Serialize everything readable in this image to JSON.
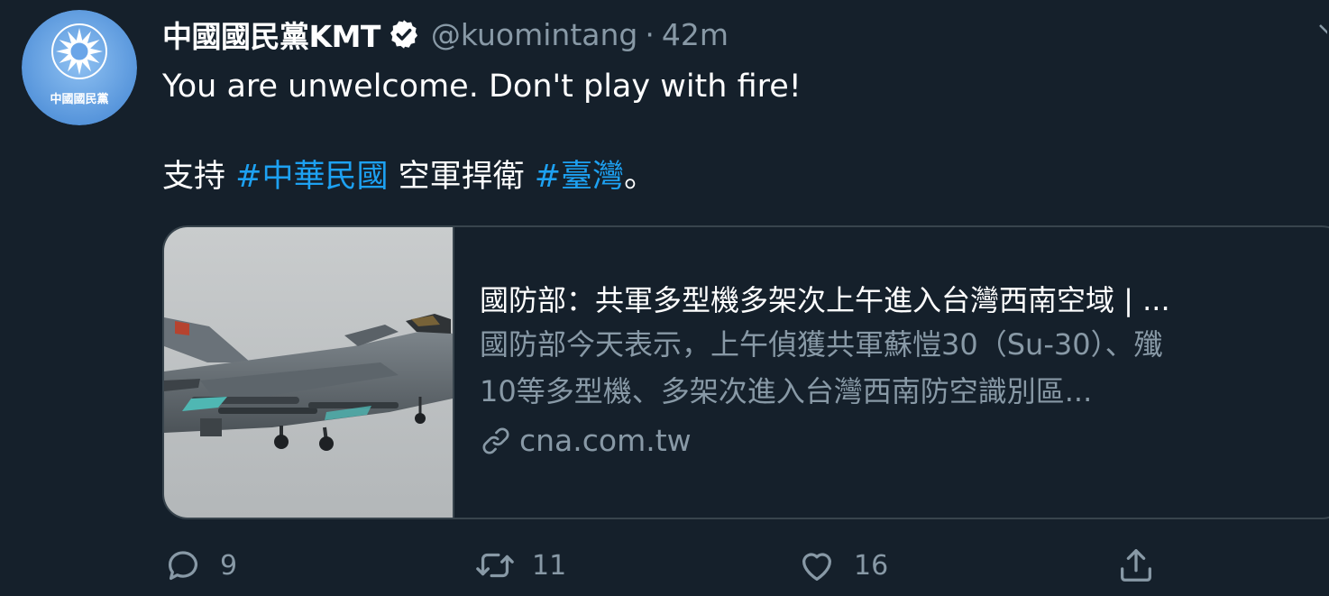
{
  "tweet": {
    "author": {
      "display_name": "中國國民黨KMT",
      "handle": "@kuomintang",
      "avatar_text": "中國國民黨",
      "verified": true
    },
    "separator": "·",
    "timestamp": "42m",
    "text_line1": "You are unwelcome. Don't play with fire!",
    "text_line2": {
      "part1": "支持 ",
      "hashtag1": "#中華民國",
      "part2": " 空軍捍衛 ",
      "hashtag2": "#臺灣",
      "part3": "。"
    },
    "card": {
      "title": "國防部：共軍多型機多架次上午進入台灣西南空域 | ...",
      "description_line1": "國防部今天表示，上午偵獲共軍蘇愷30（Su-30）、殲",
      "description_line2": "10等多型機、多架次進入台灣西南防空識別區...",
      "domain": "cna.com.tw"
    },
    "actions": {
      "reply_count": "9",
      "retweet_count": "11",
      "like_count": "16"
    }
  },
  "colors": {
    "background": "#15202b",
    "primary_text": "#ffffff",
    "secondary_text": "#8899a6",
    "accent": "#1da1f2",
    "border": "#38444d",
    "avatar_bg": "#64a0e6"
  },
  "icons": {
    "verified": "verified-badge-icon",
    "link": "link-icon",
    "reply": "reply-icon",
    "retweet": "retweet-icon",
    "like": "heart-icon",
    "share": "share-icon",
    "more": "chevron-down-icon"
  }
}
